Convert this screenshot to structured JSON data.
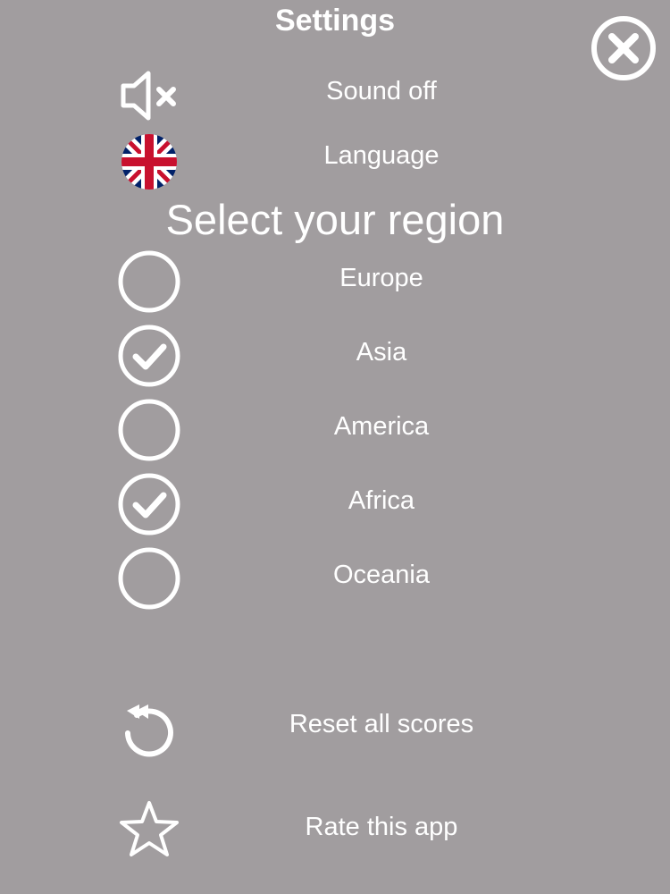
{
  "header": {
    "title": "Settings",
    "close_icon": "close-circle-icon"
  },
  "settings": {
    "sound": {
      "label": "Sound off",
      "icon": "speaker-muted-icon"
    },
    "language": {
      "label": "Language",
      "icon": "uk-flag-icon"
    }
  },
  "region": {
    "heading": "Select your region",
    "options": [
      {
        "label": "Europe",
        "selected": false
      },
      {
        "label": "Asia",
        "selected": true
      },
      {
        "label": "America",
        "selected": false
      },
      {
        "label": "Africa",
        "selected": true
      },
      {
        "label": "Oceania",
        "selected": false
      }
    ]
  },
  "actions": {
    "reset": {
      "label": "Reset all scores",
      "icon": "reset-arrow-icon"
    },
    "rate": {
      "label": "Rate this app",
      "icon": "star-outline-icon"
    }
  },
  "colors": {
    "background": "#a19d9f",
    "foreground": "#ffffff",
    "flag_blue": "#012169",
    "flag_red": "#c8102e"
  }
}
